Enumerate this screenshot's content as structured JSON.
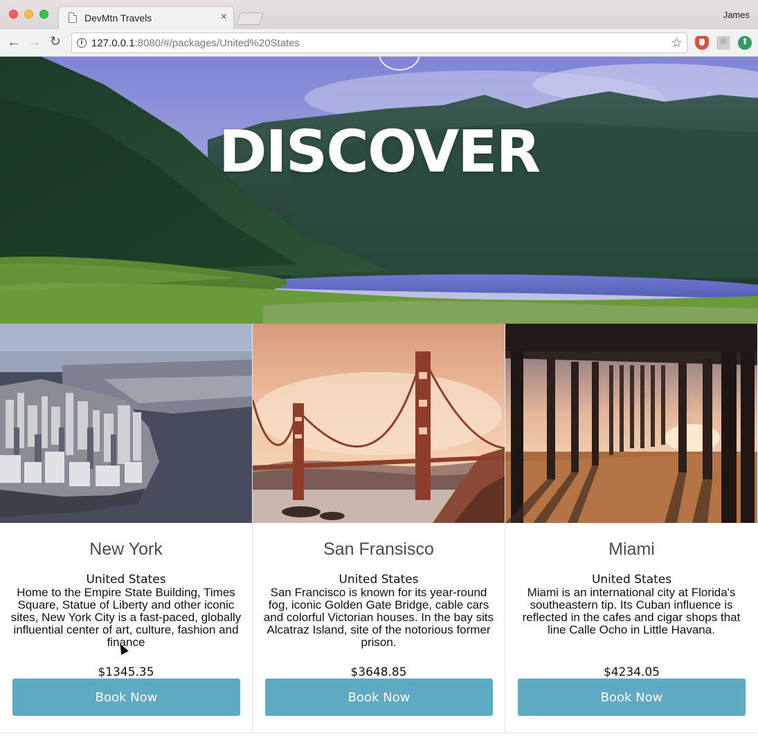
{
  "browser": {
    "tab_title": "DevMtn Travels",
    "tab_close": "×",
    "profile": "James",
    "url_host": "127.0.0.1",
    "url_rest": ":8080/#/packages/United%20States",
    "nav_back": "←",
    "nav_forward": "→",
    "nav_reload": "↻",
    "bookmark_star": "☆",
    "info_glyph": "i"
  },
  "hero": {
    "title": "DISCOVER"
  },
  "packages": [
    {
      "city": "New York",
      "country": "United States",
      "description": "Home to the Empire State Building, Times Square, Statue of Liberty and other iconic sites, New York City is a fast-paced, globally influential center of art, culture, fashion and finance",
      "price": "$1345.35",
      "button": "Book Now"
    },
    {
      "city": "San Fransisco",
      "country": "United States",
      "description": "San Francisco is known for its year-round fog, iconic Golden Gate Bridge, cable cars and colorful Victorian houses. In the bay sits Alcatraz Island, site of the notorious former prison.",
      "price": "$3648.85",
      "button": "Book Now"
    },
    {
      "city": "Miami",
      "country": "United States",
      "description": "Miami is an international city at Florida's southeastern tip. Its Cuban influence is reflected in the cafes and cigar shops that line Calle Ocho in Little Havana.",
      "price": "$4234.05",
      "button": "Book Now"
    }
  ],
  "colors": {
    "button": "#5eaac3",
    "heading_text": "#4a4a4a"
  }
}
